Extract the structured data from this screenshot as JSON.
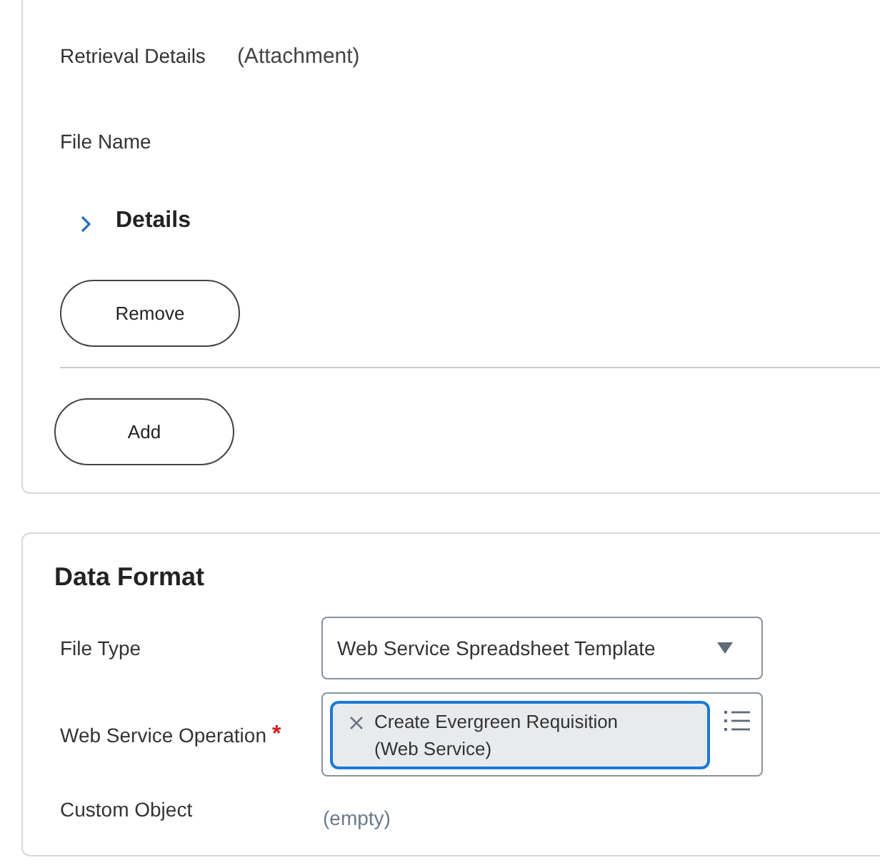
{
  "attachment_card": {
    "fields": [
      {
        "label": "Retrieval Details",
        "value": "(Attachment)"
      },
      {
        "label": "File Name"
      }
    ],
    "details": {
      "label": "Details",
      "expanded": false
    },
    "remove_button": "Remove",
    "add_button": "Add"
  },
  "data_format": {
    "title": "Data Format",
    "file_type": {
      "label": "File Type",
      "value": "Web Service Spreadsheet Template"
    },
    "web_service_operation": {
      "label": "Web Service Operation",
      "required": "*",
      "chips": [
        "Create Evergreen Requisition (Web Service)"
      ]
    },
    "custom_object": {
      "label": "Custom Object",
      "value": "(empty)"
    }
  }
}
